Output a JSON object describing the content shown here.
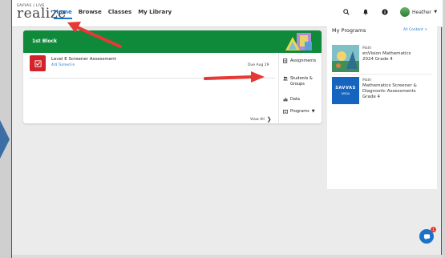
{
  "logo": {
    "top": "SAVVAS | LIVE",
    "main": "realize"
  },
  "nav": {
    "links": [
      "Home",
      "Browse",
      "Classes",
      "My Library"
    ],
    "user_name": "Heather"
  },
  "class_card": {
    "title": "1st Block",
    "assignment": {
      "title": "Level E Screener Assessment",
      "status": "4/4 Turned in",
      "due": "Due Aug 29"
    },
    "view_all": "View All",
    "menu": [
      {
        "label": "Assignments",
        "icon": "assignments-icon"
      },
      {
        "label": "Students & Groups",
        "label_line1": "Students &",
        "label_line2": "Groups",
        "icon": "students-icon"
      },
      {
        "label": "Data",
        "icon": "data-icon"
      },
      {
        "label": "Programs",
        "icon": "programs-icon"
      }
    ]
  },
  "programs": {
    "title": "My Programs",
    "all_content": "All Content >",
    "items": [
      {
        "subject": "Math",
        "name_line1": "enVision Mathematics",
        "name_line2": "2024 Grade 4"
      },
      {
        "subject": "Math",
        "name_line1": "Mathematics Screener &",
        "name_line2": "Diagnostic Assessments",
        "name_line3": "Grade 4",
        "thumb_line1": "SAVVAS",
        "thumb_line2": "MSDA"
      }
    ]
  },
  "chat": {
    "badge": "1"
  },
  "colors": {
    "brand_blue": "#1a73c8",
    "class_green": "#0e8a3a",
    "assignment_red": "#d2232a",
    "annotation_red": "#e53935"
  }
}
